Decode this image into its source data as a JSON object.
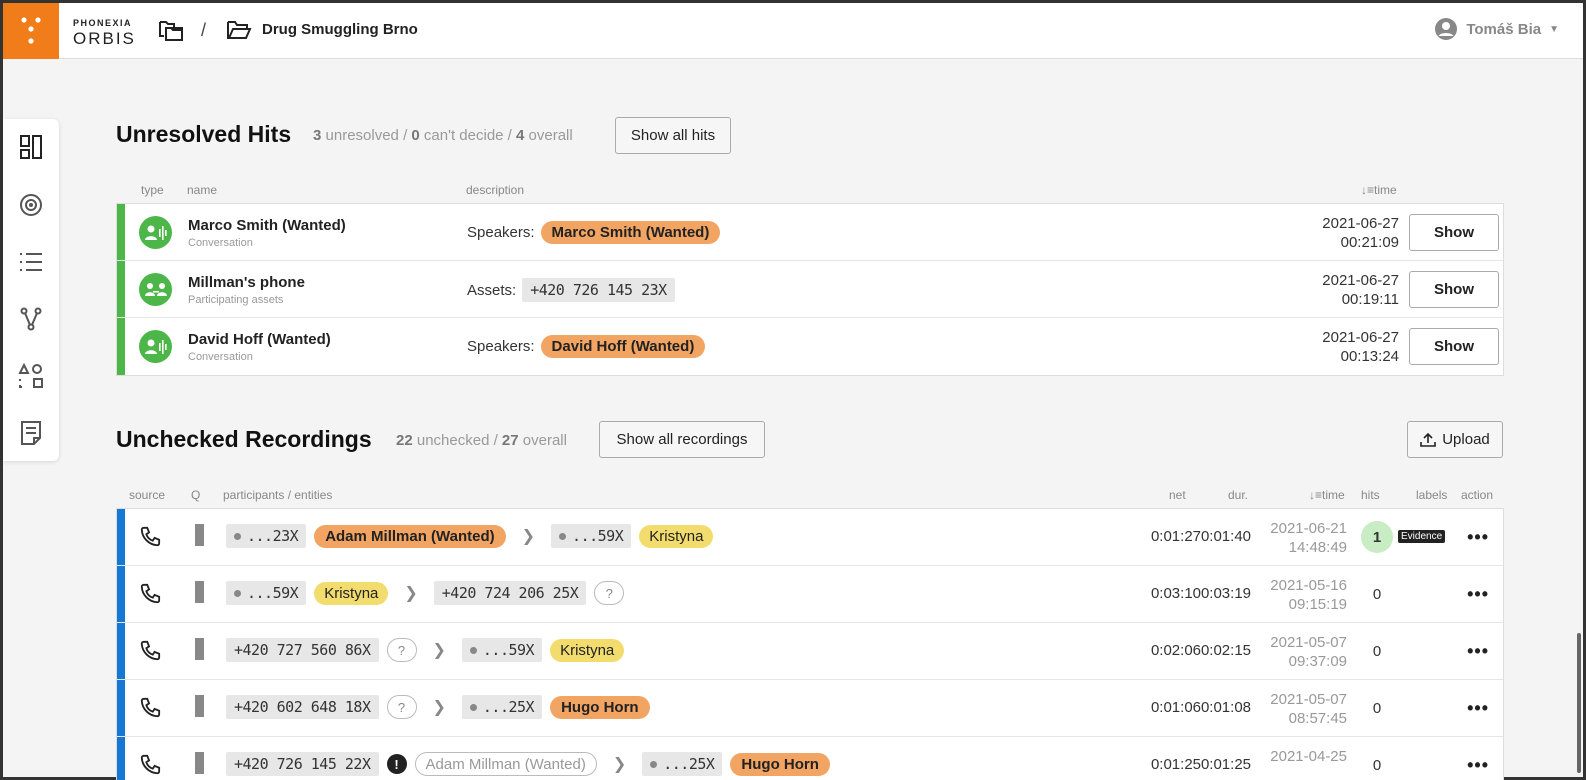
{
  "app": {
    "brand_top": "PHONEXIA",
    "brand_bottom": "ORBIS",
    "breadcrumb_separator": "/",
    "case_title": "Drug Smuggling Brno",
    "user_name": "Tomáš Bia",
    "accent": "#f07d1a"
  },
  "hits_section": {
    "title": "Unresolved Hits",
    "stats": {
      "unresolved_count": "3",
      "unresolved_text": "unresolved /",
      "cant_decide_count": "0",
      "cant_decide_text": "can't decide /",
      "overall_count": "4",
      "overall_text": "overall"
    },
    "show_all_label": "Show all hits",
    "columns": {
      "type": "type",
      "name": "name",
      "description": "description",
      "time": "time"
    },
    "rows": [
      {
        "name": "Marco Smith (Wanted)",
        "sub": "Conversation",
        "desc_label": "Speakers:",
        "desc_value": "Marco Smith (Wanted)",
        "desc_kind": "speaker",
        "date": "2021-06-27",
        "time": "00:21:09",
        "action": "Show",
        "icon": "speaker-icon"
      },
      {
        "name": "Millman's phone",
        "sub": "Participating assets",
        "desc_label": "Assets:",
        "desc_value": "+420 726 145 23X",
        "desc_kind": "asset",
        "date": "2021-06-27",
        "time": "00:19:11",
        "action": "Show",
        "icon": "people-icon"
      },
      {
        "name": "David Hoff (Wanted)",
        "sub": "Conversation",
        "desc_label": "Speakers:",
        "desc_value": "David Hoff (Wanted)",
        "desc_kind": "speaker",
        "date": "2021-06-27",
        "time": "00:13:24",
        "action": "Show",
        "icon": "speaker-icon"
      }
    ]
  },
  "recordings_section": {
    "title": "Unchecked Recordings",
    "stats": {
      "unchecked_count": "22",
      "unchecked_text": "unchecked /",
      "overall_count": "27",
      "overall_text": "overall"
    },
    "show_all_label": "Show all recordings",
    "upload_label": "Upload",
    "columns": {
      "source": "source",
      "q": "Q",
      "participants": "participants / entities",
      "net": "net",
      "dur": "dur.",
      "time": "time",
      "hits": "hits",
      "labels": "labels",
      "action": "action"
    },
    "rows": [
      {
        "a_num": "...23X",
        "a_dot": true,
        "a_entity": "Adam Millman (Wanted)",
        "a_kind": "orange",
        "b_num": "...59X",
        "b_dot": true,
        "b_entity": "Kristyna",
        "b_kind": "yellow",
        "net": "0:01:27",
        "dur": "0:01:40",
        "date": "2021-06-21",
        "time": "14:48:49",
        "hits": "1",
        "label": "Evidence"
      },
      {
        "a_num": "...59X",
        "a_dot": true,
        "a_entity": "Kristyna",
        "a_kind": "yellow",
        "b_num": "+420 724 206 25X",
        "b_dot": false,
        "b_entity": "?",
        "b_kind": "unknown",
        "net": "0:03:10",
        "dur": "0:03:19",
        "date": "2021-05-16",
        "time": "09:15:19",
        "hits": "0",
        "label": ""
      },
      {
        "a_num": "+420 727 560 86X",
        "a_dot": false,
        "a_entity": "?",
        "a_kind": "unknown",
        "b_num": "...59X",
        "b_dot": true,
        "b_entity": "Kristyna",
        "b_kind": "yellow",
        "net": "0:02:06",
        "dur": "0:02:15",
        "date": "2021-05-07",
        "time": "09:37:09",
        "hits": "0",
        "label": ""
      },
      {
        "a_num": "+420 602 648 18X",
        "a_dot": false,
        "a_entity": "?",
        "a_kind": "unknown",
        "b_num": "...25X",
        "b_dot": true,
        "b_entity": "Hugo Horn",
        "b_kind": "orange",
        "net": "0:01:06",
        "dur": "0:01:08",
        "date": "2021-05-07",
        "time": "08:57:45",
        "hits": "0",
        "label": ""
      },
      {
        "a_num": "+420 726 145 22X",
        "a_dot": false,
        "a_entity": "Adam Millman (Wanted)",
        "a_kind": "warn",
        "b_num": "...25X",
        "b_dot": true,
        "b_entity": "Hugo Horn",
        "b_kind": "orange",
        "net": "0:01:25",
        "dur": "0:01:25",
        "date": "2021-04-25",
        "time": "",
        "hits": "0",
        "label": ""
      }
    ]
  },
  "colors": {
    "hit_bar": "#4cb648",
    "rec_bar": "#1478d4",
    "speaker_pill": "#f2a462",
    "entity_pill": "#f3dc6e"
  }
}
